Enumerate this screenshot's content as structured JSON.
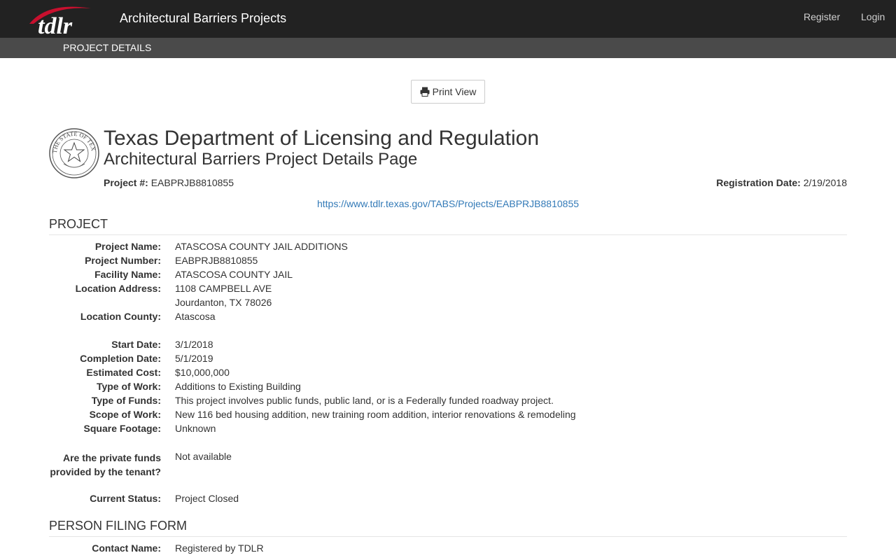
{
  "header": {
    "logo_text": "tdlr",
    "app_title": "Architectural Barriers Projects",
    "nav": {
      "register": "Register",
      "login": "Login"
    }
  },
  "subnav": {
    "label": "PROJECT DETAILS"
  },
  "toolbar": {
    "print_label": "Print View",
    "print_icon": "printer-icon"
  },
  "page": {
    "seal_text": "THE STATE OF TEXAS",
    "org_title": "Texas Department of Licensing and Regulation",
    "subtitle": "Architectural Barriers Project Details Page",
    "project_number_label": "Project #:",
    "project_number": "EABPRJB8810855",
    "registration_label": "Registration Date:",
    "registration_date": "2/19/2018",
    "url": "https://www.tdlr.texas.gov/TABS/Projects/EABPRJB8810855"
  },
  "project_section": {
    "heading": "PROJECT",
    "fields": {
      "project_name": {
        "label": "Project Name:",
        "value": "ATASCOSA COUNTY JAIL ADDITIONS"
      },
      "project_number": {
        "label": "Project Number:",
        "value": "EABPRJB8810855"
      },
      "facility_name": {
        "label": "Facility Name:",
        "value": "ATASCOSA COUNTY JAIL"
      },
      "location_address": {
        "label": "Location Address:",
        "line1": "1108 CAMPBELL AVE",
        "line2": "Jourdanton, TX 78026"
      },
      "location_county": {
        "label": "Location County:",
        "value": "Atascosa"
      },
      "start_date": {
        "label": "Start Date:",
        "value": "3/1/2018"
      },
      "completion_date": {
        "label": "Completion Date:",
        "value": "5/1/2019"
      },
      "estimated_cost": {
        "label": "Estimated Cost:",
        "value": "$10,000,000"
      },
      "type_of_work": {
        "label": "Type of Work:",
        "value": "Additions to Existing Building"
      },
      "type_of_funds": {
        "label": "Type of Funds:",
        "value": "This project involves public funds, public land, or is a Federally funded roadway project."
      },
      "scope_of_work": {
        "label": "Scope of Work:",
        "value": "New 116 bed housing addition, new training room addition, interior renovations & remodeling"
      },
      "square_footage": {
        "label": "Square Footage:",
        "value": "Unknown"
      },
      "private_funds": {
        "label_line1": "Are the private funds",
        "label_line2": "provided by the tenant?",
        "value": "Not available"
      },
      "current_status": {
        "label": "Current Status:",
        "value": "Project Closed"
      }
    }
  },
  "filer_section": {
    "heading": "PERSON FILING FORM",
    "contact_name": {
      "label": "Contact Name:",
      "value": "Registered by TDLR"
    }
  },
  "colors": {
    "topbar": "#222222",
    "subbar": "#4a4a4a",
    "link": "#337ab7",
    "logo_red": "#c8102e"
  }
}
